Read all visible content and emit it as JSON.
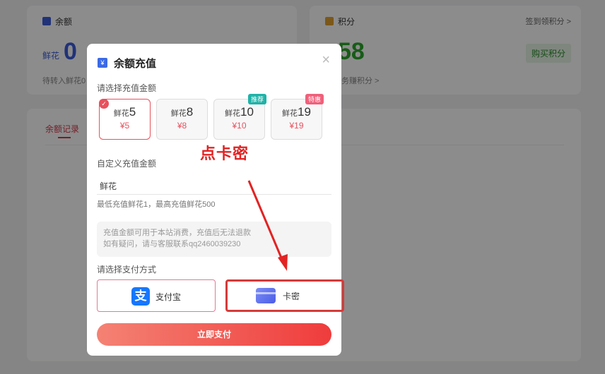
{
  "background": {
    "balance_card": {
      "title": "余额",
      "amount": "0",
      "currency": "鲜花",
      "pending": "待转入鲜花0"
    },
    "points_card": {
      "title": "积分",
      "amount": "58",
      "sign_link": "签到领积分 >",
      "buy_button": "购买积分",
      "earn_link": "务赚积分 >"
    },
    "records_tab": "余额记录"
  },
  "modal": {
    "title": "余额充值",
    "close_icon": "close-icon",
    "choose_label": "请选择充值金额",
    "amounts": [
      {
        "unit": "鲜花",
        "value": "5",
        "price": "¥5",
        "selected": true,
        "badge": ""
      },
      {
        "unit": "鲜花",
        "value": "8",
        "price": "¥8",
        "selected": false,
        "badge": ""
      },
      {
        "unit": "鲜花",
        "value": "10",
        "price": "¥10",
        "selected": false,
        "badge": "推荐"
      },
      {
        "unit": "鲜花",
        "value": "19",
        "price": "¥19",
        "selected": false,
        "badge": "特惠"
      }
    ],
    "custom_label": "自定义充值金额",
    "custom_value": "鲜花",
    "custom_hint": "最低充值鲜花1，最高充值鲜花500",
    "notice_line1": "充值金额可用于本站消费，充值后无法退款",
    "notice_line2": "如有疑问，请与客服联系qq2460039230",
    "pay_method_label": "请选择支付方式",
    "pay_methods": [
      {
        "name": "支付宝",
        "icon": "alipay-icon"
      },
      {
        "name": "卡密",
        "icon": "card-icon"
      }
    ],
    "pay_button": "立即支付"
  },
  "annotation": {
    "text": "点卡密"
  },
  "colors": {
    "accent_red": "#e8515d",
    "annotation_red": "#e22323",
    "points_green": "#2aa82a",
    "balance_blue": "#3b5bdb"
  }
}
